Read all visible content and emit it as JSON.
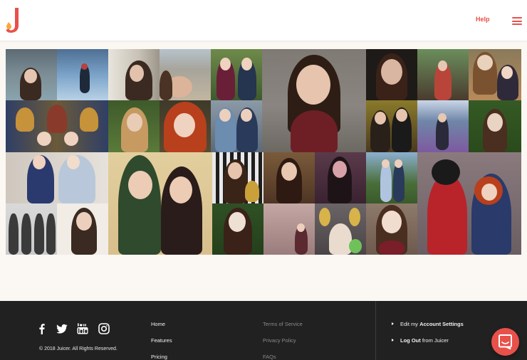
{
  "header": {
    "logo_letter": "J",
    "logo_icon": "juicer-logo-icon",
    "help_label": "Help",
    "menu_icon": "hamburger-menu-icon",
    "accent_color": "#e8514a"
  },
  "gallery": {
    "photos": [
      {
        "name": "photo-girls-by-lake",
        "colors": [
          "#5b6a73",
          "#8aa4ad"
        ]
      },
      {
        "name": "photo-snowy-mountain",
        "colors": [
          "#7aa3c8",
          "#b8d1e6"
        ]
      },
      {
        "name": "photo-selfie-window",
        "colors": [
          "#c7c1b6",
          "#3b2a22"
        ]
      },
      {
        "name": "photo-beach-selfie",
        "colors": [
          "#a7a49b",
          "#c2b6a1"
        ]
      },
      {
        "name": "photo-two-friends-green",
        "colors": [
          "#3f5a2e",
          "#6e8a4a"
        ]
      },
      {
        "name": "photo-portrait-red-dress",
        "colors": [
          "#8a8580",
          "#6e1f26"
        ]
      },
      {
        "name": "photo-headshot-dark",
        "colors": [
          "#1e1a18",
          "#d8b6a2"
        ]
      },
      {
        "name": "photo-garden-red-dress",
        "colors": [
          "#4a3b2e",
          "#b9453a"
        ]
      },
      {
        "name": "photo-with-chipmunk",
        "colors": [
          "#b88a5a",
          "#7a5230"
        ]
      },
      {
        "name": "photo-colorful-tapestry",
        "colors": [
          "#2f3f66",
          "#c6923a"
        ]
      },
      {
        "name": "photo-woman-in-garden",
        "colors": [
          "#3e5a2a",
          "#d1b38f"
        ]
      },
      {
        "name": "photo-red-curly-hair",
        "colors": [
          "#8e2a14",
          "#d9673a"
        ]
      },
      {
        "name": "photo-two-friends-blue",
        "colors": [
          "#6c8cb0",
          "#2a3a5a"
        ]
      },
      {
        "name": "photo-couple-with-trophy",
        "colors": [
          "#4a3a1e",
          "#e2c76a"
        ]
      },
      {
        "name": "photo-castle-garden",
        "colors": [
          "#6f86a8",
          "#7d5aa0"
        ]
      },
      {
        "name": "photo-hedge-smile",
        "colors": [
          "#355a24",
          "#e9d3c3"
        ]
      },
      {
        "name": "photo-princess-costumes",
        "colors": [
          "#d9d3cc",
          "#2b3a6e"
        ]
      },
      {
        "name": "photo-green-costume-pair",
        "colors": [
          "#d8bf8c",
          "#2f4a2c"
        ]
      },
      {
        "name": "photo-striped-wall",
        "colors": [
          "#e8e8e8",
          "#1e1e1e"
        ]
      },
      {
        "name": "photo-wooden-wall",
        "colors": [
          "#7a5a3a",
          "#4e3524"
        ]
      },
      {
        "name": "photo-pink-lights",
        "colors": [
          "#5a3a4a",
          "#d8a0a8"
        ]
      },
      {
        "name": "photo-park-friends",
        "colors": [
          "#4a6e3a",
          "#8cb0d0"
        ]
      },
      {
        "name": "photo-minnie-and-merida",
        "colors": [
          "#8a7a7e",
          "#b8242a"
        ]
      },
      {
        "name": "photo-dancers-lineup",
        "colors": [
          "#c9c9c9",
          "#3a3a3a"
        ]
      },
      {
        "name": "photo-white-backdrop",
        "colors": [
          "#f1ece6",
          "#3a2a22"
        ]
      },
      {
        "name": "photo-ivy-portrait",
        "colors": [
          "#2f5024",
          "#efe0d4"
        ]
      },
      {
        "name": "photo-neon-sign",
        "colors": [
          "#c4a8a4",
          "#ff8fa0"
        ]
      },
      {
        "name": "photo-balloons-party",
        "colors": [
          "#6a6466",
          "#d7b34a"
        ]
      },
      {
        "name": "photo-smile-closeup",
        "colors": [
          "#8e7a6a",
          "#f1ddd0"
        ]
      }
    ]
  },
  "footer": {
    "social_icons": [
      "facebook-icon",
      "twitter-icon",
      "youtube-icon",
      "instagram-icon"
    ],
    "copyright": "© 2018 Juicer. All Rights Reserved.",
    "nav_links": [
      "Home",
      "Features",
      "Pricing"
    ],
    "legal_links": [
      "Terms of Service",
      "Privacy Policy",
      "FAQs"
    ],
    "account": {
      "settings_prefix": "Edit my ",
      "settings_strong": "Account Settings",
      "logout_strong": "Log Out",
      "logout_suffix": " from Juicer"
    }
  },
  "chat": {
    "icon": "chat-bubble-icon"
  }
}
